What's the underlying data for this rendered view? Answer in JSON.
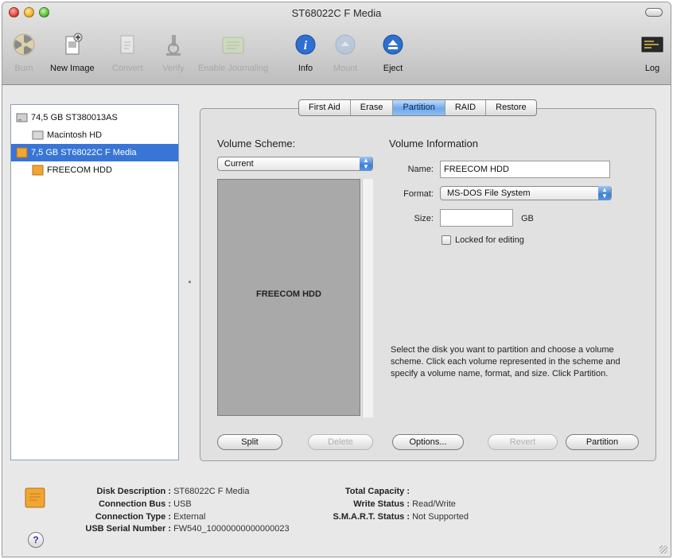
{
  "window": {
    "title": "ST68022C F Media"
  },
  "toolbar": {
    "items": [
      {
        "label": "Burn",
        "icon": "burn-icon",
        "enabled": false
      },
      {
        "label": "New Image",
        "icon": "new-image-icon",
        "enabled": true
      },
      {
        "label": "Convert",
        "icon": "convert-icon",
        "enabled": false
      },
      {
        "label": "Verify",
        "icon": "verify-icon",
        "enabled": false
      },
      {
        "label": "Enable Journaling",
        "icon": "journaling-icon",
        "enabled": false
      },
      {
        "label": "Info",
        "icon": "info-icon",
        "enabled": true
      },
      {
        "label": "Mount",
        "icon": "mount-icon",
        "enabled": false
      },
      {
        "label": "Eject",
        "icon": "eject-icon",
        "enabled": true
      },
      {
        "label": "Log",
        "icon": "log-icon",
        "enabled": true
      }
    ]
  },
  "sidebar": {
    "items": [
      {
        "label": "74,5 GB ST380013AS",
        "level": 0,
        "selected": false,
        "icon": "internal-disk-icon"
      },
      {
        "label": "Macintosh HD",
        "level": 1,
        "selected": false,
        "icon": "volume-icon"
      },
      {
        "label": "7,5 GB ST68022C F Media",
        "level": 0,
        "selected": true,
        "icon": "external-disk-icon"
      },
      {
        "label": "FREECOM HDD",
        "level": 1,
        "selected": false,
        "icon": "external-volume-icon"
      }
    ]
  },
  "tabs": [
    {
      "label": "First Aid",
      "active": false
    },
    {
      "label": "Erase",
      "active": false
    },
    {
      "label": "Partition",
      "active": true
    },
    {
      "label": "RAID",
      "active": false
    },
    {
      "label": "Restore",
      "active": false
    }
  ],
  "partition": {
    "volume_scheme_title": "Volume Scheme:",
    "scheme_popup_value": "Current",
    "scheme_volume_label": "FREECOM HDD",
    "volume_info_title": "Volume Information",
    "name_label": "Name:",
    "name_value": "FREECOM HDD",
    "format_label": "Format:",
    "format_value": "MS-DOS File System",
    "size_label": "Size:",
    "size_value": "",
    "size_unit": "GB",
    "locked_label": "Locked for editing",
    "locked_checked": false,
    "help_text": "Select the disk you want to partition and choose a volume scheme. Click each volume represented in the scheme and specify a volume name, format, and size. Click Partition.",
    "buttons": {
      "split": "Split",
      "delete": "Delete",
      "options": "Options...",
      "revert": "Revert",
      "partition": "Partition"
    }
  },
  "disk_info": {
    "disk_description_key": "Disk Description :",
    "disk_description_val": "ST68022C F Media",
    "connection_bus_key": "Connection Bus :",
    "connection_bus_val": "USB",
    "connection_type_key": "Connection Type :",
    "connection_type_val": "External",
    "usb_serial_key": "USB Serial Number :",
    "usb_serial_val": "FW540_10000000000000023",
    "total_capacity_key": "Total Capacity :",
    "total_capacity_val": "",
    "write_status_key": "Write Status :",
    "write_status_val": "Read/Write",
    "smart_status_key": "S.M.A.R.T. Status :",
    "smart_status_val": "Not Supported"
  },
  "help_button": "?",
  "colors": {
    "selection": "#3875d7",
    "tab_active": "#6fa9ea",
    "popup_arrows": "#3d7fd3",
    "scheme_fill": "#a9a9a9"
  }
}
